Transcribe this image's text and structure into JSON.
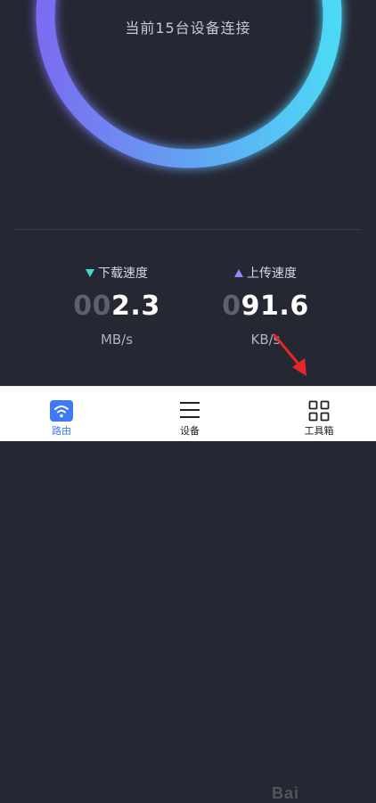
{
  "status": {
    "device_count_text": "当前15台设备连接"
  },
  "download": {
    "label": "下载速度",
    "value_dim": "00",
    "value_main": "2.3",
    "unit": "MB/s"
  },
  "upload": {
    "label": "上传速度",
    "value_dim": "0",
    "value_main": "91.6",
    "unit": "KB/s"
  },
  "tabs": [
    {
      "label": "路由",
      "icon": "wifi-icon",
      "active": true
    },
    {
      "label": "设备",
      "icon": "menu-icon",
      "active": false
    },
    {
      "label": "工具箱",
      "icon": "grid-icon",
      "active": false
    }
  ],
  "watermark": "Bai",
  "colors": {
    "background": "#252733",
    "ring_start": "#7a6df0",
    "ring_end": "#4dd8f5",
    "download_accent": "#41d9d0",
    "upload_accent": "#8a8cff",
    "tab_active": "#3d7bf6",
    "annotation_arrow": "#e8262a"
  }
}
